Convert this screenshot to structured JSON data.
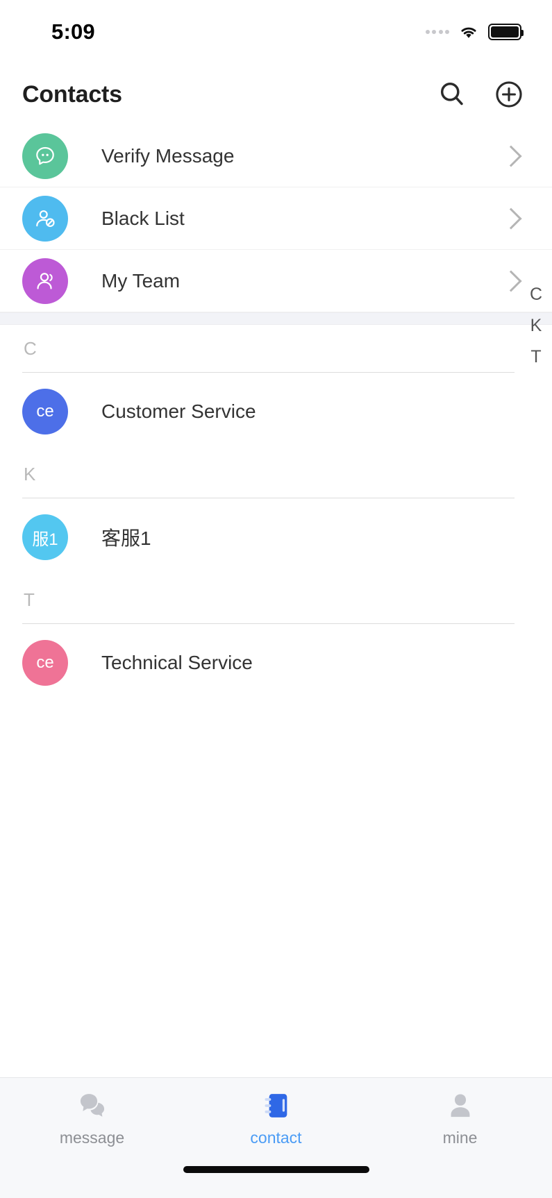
{
  "status_bar": {
    "time": "5:09",
    "signal_icon": "signal-dots-icon",
    "wifi_icon": "wifi-icon",
    "battery_icon": "battery-icon"
  },
  "header": {
    "title": "Contacts",
    "search_icon": "search-icon",
    "add_icon": "plus-circle-icon"
  },
  "group_rows": [
    {
      "label": "Verify Message",
      "icon": "chat-bubble-icon",
      "color": "#5ac59a",
      "chevron": "chevron-right-icon"
    },
    {
      "label": "Black List",
      "icon": "user-block-icon",
      "color": "#4fbbef",
      "chevron": "chevron-right-icon"
    },
    {
      "label": "My Team",
      "icon": "users-group-icon",
      "color": "#bd5ad6",
      "chevron": "chevron-right-icon"
    }
  ],
  "sections": [
    {
      "letter": "C",
      "contacts": [
        {
          "name": "Customer Service",
          "initials": "ce",
          "color": "#4d6fe8"
        }
      ]
    },
    {
      "letter": "K",
      "contacts": [
        {
          "name": "客服1",
          "initials": "服1",
          "color": "#53c7f0"
        }
      ]
    },
    {
      "letter": "T",
      "contacts": [
        {
          "name": "Technical Service",
          "initials": "ce",
          "color": "#ef7396"
        }
      ]
    }
  ],
  "index_bar": [
    "C",
    "K",
    "T"
  ],
  "tab_bar": {
    "tabs": [
      {
        "label": "message",
        "icon": "chat-bubbles-icon",
        "active": false
      },
      {
        "label": "contact",
        "icon": "address-book-icon",
        "active": true
      },
      {
        "label": "mine",
        "icon": "person-icon",
        "active": false
      }
    ],
    "active_color": "#4b9cf5",
    "inactive_color": "#c3c5cb"
  },
  "home_indicator": "home-indicator-bar"
}
